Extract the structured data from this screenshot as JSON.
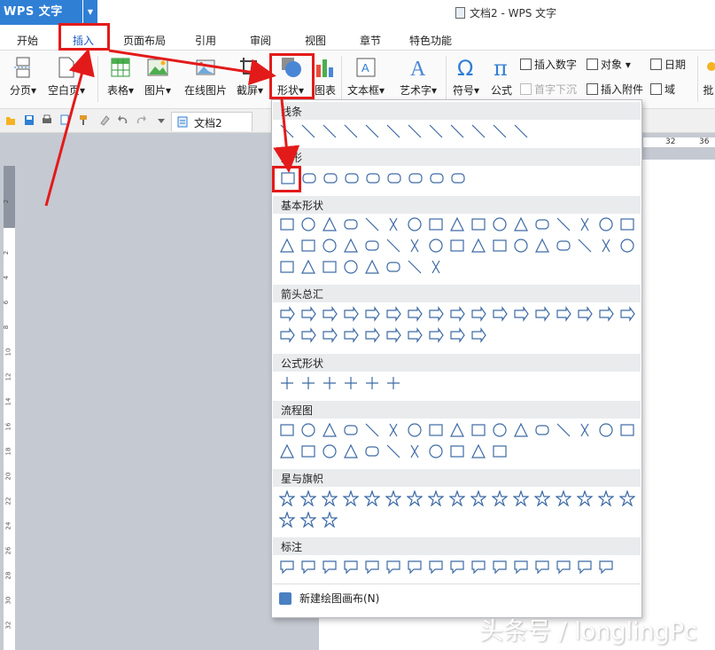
{
  "app": {
    "logo": "WPS 文字",
    "window_title": "文档2 - WPS 文字"
  },
  "menu_tabs": [
    {
      "label": "开始"
    },
    {
      "label": "插入"
    },
    {
      "label": "页面布局"
    },
    {
      "label": "引用"
    },
    {
      "label": "审阅"
    },
    {
      "label": "视图"
    },
    {
      "label": "章节"
    },
    {
      "label": "特色功能"
    }
  ],
  "ribbon": {
    "page_break": "分页",
    "blank_page": "空白页",
    "table": "表格",
    "picture": "图片",
    "online_picture": "在线图片",
    "screenshot": "截屏",
    "shape": "形状",
    "chart": "图表",
    "textbox": "文本框",
    "wordart": "艺术字",
    "symbol": "符号",
    "formula": "公式",
    "insert_number": "插入数字",
    "object": "对象",
    "date": "日期",
    "dropcap": "首字下沉",
    "attachment": "插入附件",
    "field": "域",
    "batch": "批"
  },
  "quickbar": {
    "doc_tab": "文档2"
  },
  "ruler": {
    "h_ticks": [
      "32",
      "36"
    ],
    "v_ticks": [
      "2",
      "2",
      "4",
      "6",
      "8",
      "10",
      "12",
      "14",
      "16",
      "18",
      "20",
      "22",
      "24",
      "26",
      "28",
      "30",
      "32"
    ]
  },
  "shapes_menu": {
    "sections": [
      {
        "title": "线条",
        "count": 12
      },
      {
        "title": "矩形",
        "count": 9
      },
      {
        "title": "基本形状",
        "count": 42
      },
      {
        "title": "箭头总汇",
        "count": 27
      },
      {
        "title": "公式形状",
        "count": 6
      },
      {
        "title": "流程图",
        "count": 28
      },
      {
        "title": "星与旗帜",
        "count": 20
      },
      {
        "title": "标注",
        "count": 16
      }
    ],
    "new_canvas": "新建绘图画布(N)"
  },
  "watermark": "头条号 / longlingPc",
  "colors": {
    "brand": "#2f7fd5",
    "highlight": "#e31a1a",
    "shape_stroke": "#3d6aa5"
  }
}
